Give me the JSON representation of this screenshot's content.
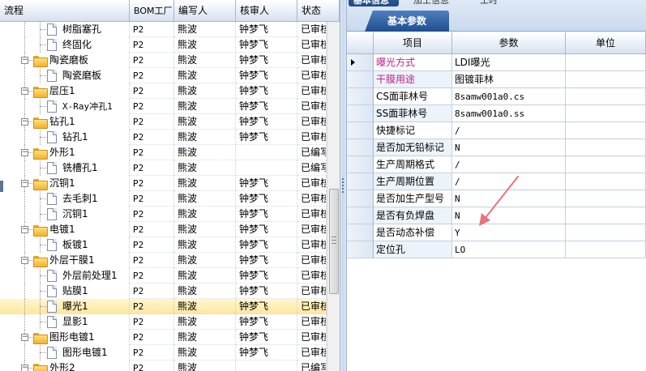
{
  "tree": {
    "columns": [
      "流程",
      "BOM工厂",
      "编写人",
      "核审人",
      "状态"
    ],
    "rows": [
      {
        "label": "树脂塞孔",
        "level": 2,
        "type": "doc",
        "factory": "P2",
        "writer": "熊波",
        "reviewer": "钟梦飞",
        "status": "已审核"
      },
      {
        "label": "终固化",
        "level": 2,
        "type": "doc",
        "factory": "P2",
        "writer": "熊波",
        "reviewer": "钟梦飞",
        "status": "已审核"
      },
      {
        "label": "陶瓷磨板",
        "level": 1,
        "type": "folder",
        "factory": "P2",
        "writer": "熊波",
        "reviewer": "钟梦飞",
        "status": "已审核"
      },
      {
        "label": "陶瓷磨板",
        "level": 2,
        "type": "doc",
        "factory": "P2",
        "writer": "熊波",
        "reviewer": "钟梦飞",
        "status": "已审核"
      },
      {
        "label": "层压1",
        "level": 1,
        "type": "folder",
        "factory": "P2",
        "writer": "熊波",
        "reviewer": "钟梦飞",
        "status": "已审核"
      },
      {
        "label": "X-Ray冲孔1",
        "level": 2,
        "type": "doc",
        "factory": "P2",
        "writer": "熊波",
        "reviewer": "钟梦飞",
        "status": "已审核"
      },
      {
        "label": "钻孔1",
        "level": 1,
        "type": "folder",
        "factory": "P2",
        "writer": "熊波",
        "reviewer": "钟梦飞",
        "status": "已审核"
      },
      {
        "label": "钻孔1",
        "level": 2,
        "type": "doc",
        "factory": "P2",
        "writer": "熊波",
        "reviewer": "钟梦飞",
        "status": "已审核"
      },
      {
        "label": "外形1",
        "level": 1,
        "type": "folder",
        "factory": "P2",
        "writer": "熊波",
        "reviewer": "",
        "status": "已编写"
      },
      {
        "label": "铣槽孔1",
        "level": 2,
        "type": "doc",
        "factory": "P2",
        "writer": "熊波",
        "reviewer": "",
        "status": "已编写"
      },
      {
        "label": "沉铜1",
        "level": 1,
        "type": "folder",
        "factory": "P2",
        "writer": "熊波",
        "reviewer": "钟梦飞",
        "status": "已审核"
      },
      {
        "label": "去毛刺1",
        "level": 2,
        "type": "doc",
        "factory": "P2",
        "writer": "熊波",
        "reviewer": "钟梦飞",
        "status": "已审核"
      },
      {
        "label": "沉铜1",
        "level": 2,
        "type": "doc",
        "factory": "P2",
        "writer": "熊波",
        "reviewer": "钟梦飞",
        "status": "已审核"
      },
      {
        "label": "电镀1",
        "level": 1,
        "type": "folder",
        "factory": "P2",
        "writer": "熊波",
        "reviewer": "钟梦飞",
        "status": "已审核"
      },
      {
        "label": "板镀1",
        "level": 2,
        "type": "doc",
        "factory": "P2",
        "writer": "熊波",
        "reviewer": "钟梦飞",
        "status": "已审核"
      },
      {
        "label": "外层干膜1",
        "level": 1,
        "type": "folder",
        "factory": "P2",
        "writer": "熊波",
        "reviewer": "钟梦飞",
        "status": "已审核"
      },
      {
        "label": "外层前处理1",
        "level": 2,
        "type": "doc",
        "factory": "P2",
        "writer": "熊波",
        "reviewer": "钟梦飞",
        "status": "已审核"
      },
      {
        "label": "贴膜1",
        "level": 2,
        "type": "doc",
        "factory": "P2",
        "writer": "熊波",
        "reviewer": "钟梦飞",
        "status": "已审核"
      },
      {
        "label": "曝光1",
        "level": 2,
        "type": "doc",
        "factory": "P2",
        "writer": "熊波",
        "reviewer": "钟梦飞",
        "status": "已审核",
        "selected": true
      },
      {
        "label": "显影1",
        "level": 2,
        "type": "doc",
        "factory": "P2",
        "writer": "熊波",
        "reviewer": "钟梦飞",
        "status": "已审核"
      },
      {
        "label": "图形电镀1",
        "level": 1,
        "type": "folder",
        "factory": "P2",
        "writer": "熊波",
        "reviewer": "钟梦飞",
        "status": "已审核"
      },
      {
        "label": "图形电镀1",
        "level": 2,
        "type": "doc",
        "factory": "P2",
        "writer": "熊波",
        "reviewer": "钟梦飞",
        "status": "已审核"
      },
      {
        "label": "外形2",
        "level": 1,
        "type": "folder",
        "factory": "P2",
        "writer": "熊波",
        "reviewer": "",
        "status": "已编写"
      }
    ]
  },
  "right": {
    "top_tabs": [
      "基本信息",
      "加工信息",
      "工时"
    ],
    "sub_tab": "基本参数",
    "columns": [
      "项目",
      "参数",
      "单位"
    ],
    "rows": [
      {
        "item": "曝光方式",
        "value": "LDI曝光",
        "unit": "",
        "color": "#c0208a",
        "current": true
      },
      {
        "item": "干膜用途",
        "value": "图镀菲林",
        "unit": "",
        "color": "#c0208a"
      },
      {
        "item": "CS面菲林号",
        "value": "8samw001a0.cs",
        "unit": ""
      },
      {
        "item": "SS面菲林号",
        "value": "8samw001a0.ss",
        "unit": ""
      },
      {
        "item": "快捷标记",
        "value": "/",
        "unit": ""
      },
      {
        "item": "是否加无铅标记",
        "value": "N",
        "unit": ""
      },
      {
        "item": "生产周期格式",
        "value": "/",
        "unit": ""
      },
      {
        "item": "生产周期位置",
        "value": "/",
        "unit": ""
      },
      {
        "item": "是否加生产型号",
        "value": "N",
        "unit": ""
      },
      {
        "item": "是否有负焊盘",
        "value": "N",
        "unit": ""
      },
      {
        "item": "是否动态补偿",
        "value": "Y",
        "unit": ""
      },
      {
        "item": "定位孔",
        "value": "LO",
        "unit": ""
      }
    ]
  },
  "colors": {
    "selected_row": "#ffe69c",
    "header_blue": "#1e4e8e",
    "highlight_text": "#c0208a",
    "annotation_arrow": "#e8737a"
  }
}
